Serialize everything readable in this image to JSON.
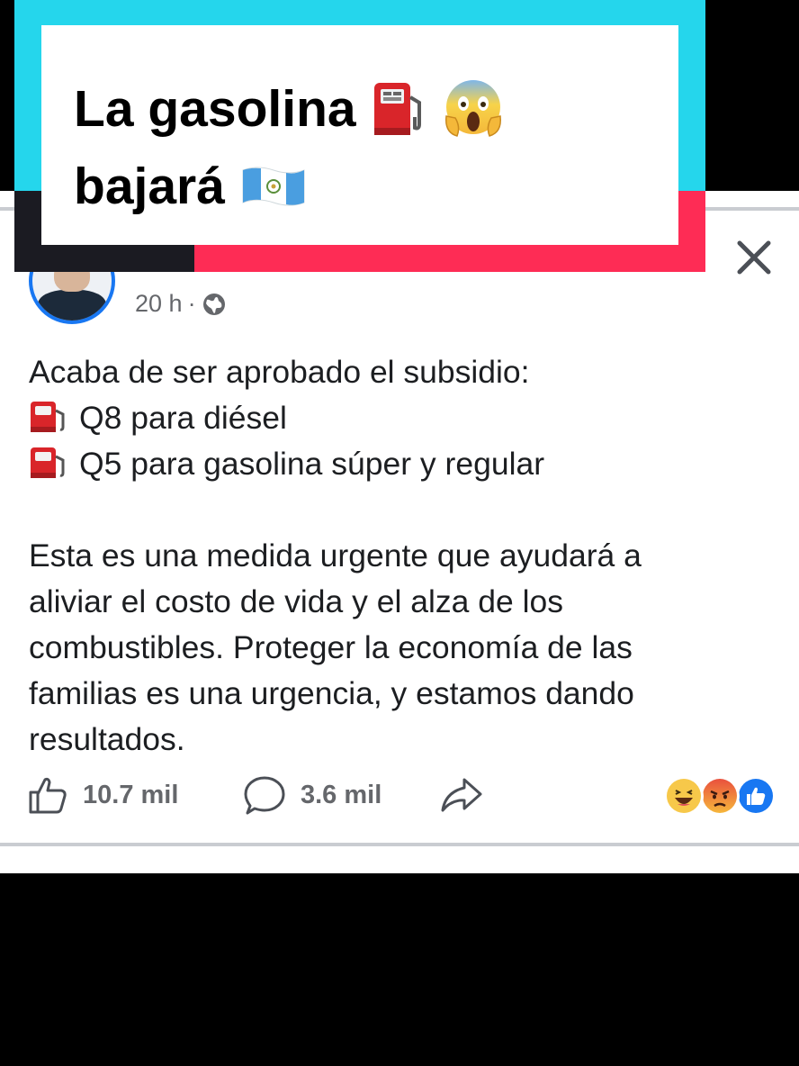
{
  "overlay": {
    "title_line1": "La gasolina",
    "title_line2": "bajará",
    "emojis": [
      "fuel-pump-icon",
      "screaming-face-icon",
      "guatemala-flag-icon"
    ],
    "colors": {
      "cyan": "#25d6ec",
      "pink": "#fe2c55",
      "dark": "#1b1b22"
    }
  },
  "post": {
    "timestamp": "20 h",
    "separator": "·",
    "body": {
      "intro": "Acaba de ser aprobado el subsidio:",
      "items": [
        "Q8 para diésel",
        "Q5 para gasolina súper y regular"
      ],
      "paragraph_lines": [
        "Esta es una medida urgente que ayudará a",
        "aliviar el costo de vida y el alza de los",
        "combustibles. Proteger la economía de las",
        "familias es una urgencia, y estamos dando",
        "resultados."
      ]
    },
    "actions": {
      "likes": "10.7 mil",
      "comments": "3.6 mil"
    },
    "reactions": [
      "haha-icon",
      "angry-icon",
      "like-icon"
    ],
    "colors": {
      "brand": "#1877f2",
      "text": "#1c1e21",
      "muted": "#65676b"
    }
  }
}
